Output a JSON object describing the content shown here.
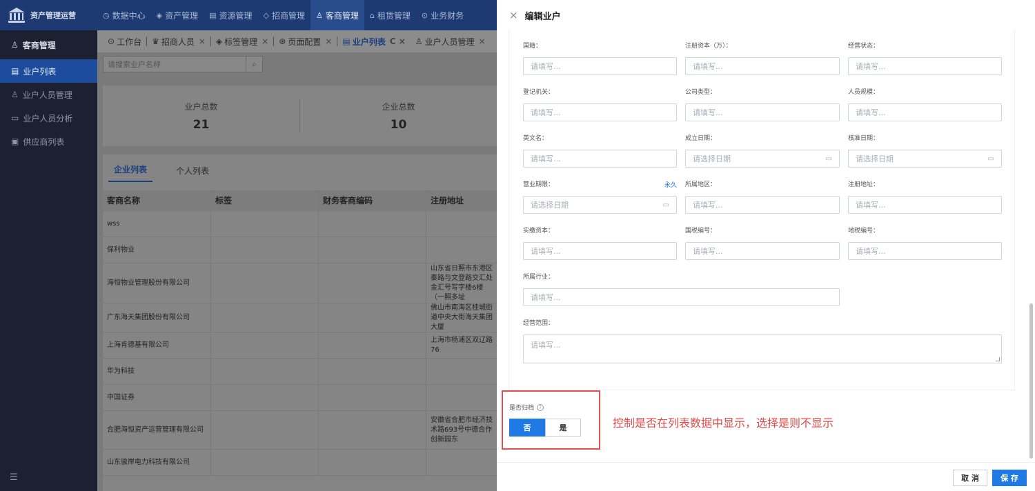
{
  "app": {
    "title": "资产管理运营"
  },
  "topnav": [
    {
      "icon": "◷",
      "label": "数据中心"
    },
    {
      "icon": "◈",
      "label": "资产管理"
    },
    {
      "icon": "▤",
      "label": "资源管理"
    },
    {
      "icon": "◇",
      "label": "招商管理"
    },
    {
      "icon": "♙",
      "label": "客商管理"
    },
    {
      "icon": "⌂",
      "label": "租赁管理"
    },
    {
      "icon": "⊙",
      "label": "业务财务"
    }
  ],
  "sidebar": {
    "header": "客商管理",
    "items": [
      {
        "icon": "▤",
        "label": "业户列表"
      },
      {
        "icon": "♙",
        "label": "业户人员管理"
      },
      {
        "icon": "▭",
        "label": "业户人员分析"
      },
      {
        "icon": "▣",
        "label": "供应商列表"
      }
    ],
    "foot_icon": "☰"
  },
  "tabs": [
    {
      "icon": "⊙",
      "label": "工作台",
      "close": ""
    },
    {
      "icon": "♛",
      "label": "招商人员",
      "close": "×"
    },
    {
      "icon": "◈",
      "label": "标签管理",
      "close": "×"
    },
    {
      "icon": "⊛",
      "label": "页面配置",
      "close": "×"
    },
    {
      "icon": "▤",
      "label": "业户列表",
      "close": "C ×"
    },
    {
      "icon": "♙",
      "label": "业户人员管理",
      "close": "×"
    }
  ],
  "search": {
    "placeholder": "请搜索业户名称",
    "icon": "⌕"
  },
  "stats": [
    {
      "label": "业户总数",
      "value": "21"
    },
    {
      "label": "企业总数",
      "value": "10"
    }
  ],
  "list_tabs": [
    "企业列表",
    "个人列表"
  ],
  "table": {
    "columns": [
      "客商名称",
      "标签",
      "财务客商编码",
      "注册地址"
    ],
    "rows": [
      {
        "name": "wss",
        "tag": "",
        "code": "",
        "addr": ""
      },
      {
        "name": "保利物业",
        "tag": "",
        "code": "",
        "addr": ""
      },
      {
        "name": "海恒物业管理股份有限公司",
        "tag": "",
        "code": "",
        "addr": "山东省日照市东港区秦路与文登路交汇处金汇号写字楼6楼（一照多址"
      },
      {
        "name": "广东海天集团股份有限公司",
        "tag": "",
        "code": "",
        "addr": "佛山市南海区桂城街道中央大街海天集团大厦"
      },
      {
        "name": "上海肯德基有限公司",
        "tag": "",
        "code": "",
        "addr": "上海市杨浦区双辽路76"
      },
      {
        "name": "华为科技",
        "tag": "",
        "code": "",
        "addr": ""
      },
      {
        "name": "中国证券",
        "tag": "",
        "code": "",
        "addr": ""
      },
      {
        "name": "合肥海恒资产运营管理有限公司",
        "tag": "",
        "code": "",
        "addr": "安徽省合肥市经济技术路693号中德合作创新园东"
      },
      {
        "name": "山东骏岸电力科技有限公司",
        "tag": "",
        "code": "",
        "addr": ""
      }
    ]
  },
  "drawer": {
    "title": "编辑业户",
    "close_icon": "×",
    "fields": [
      {
        "label": "国籍：",
        "placeholder": "请填写..."
      },
      {
        "label": "注册资本（万）：",
        "placeholder": "请填写..."
      },
      {
        "label": "经营状态：",
        "placeholder": "请填写..."
      },
      {
        "label": "登记机关：",
        "placeholder": "请填写..."
      },
      {
        "label": "公司类型：",
        "placeholder": "请填写..."
      },
      {
        "label": "人员规模：",
        "placeholder": "请填写..."
      },
      {
        "label": "英文名：",
        "placeholder": "请填写..."
      },
      {
        "label": "成立日期：",
        "placeholder": "请选择日期"
      },
      {
        "label": "核准日期：",
        "placeholder": "请选择日期"
      },
      {
        "label": "营业期限：",
        "placeholder": "请选择日期",
        "extra": "永久"
      },
      {
        "label": "所属地区：",
        "placeholder": "请填写..."
      },
      {
        "label": "注册地址：",
        "placeholder": "请填写..."
      },
      {
        "label": "实缴资本：",
        "placeholder": "请填写..."
      },
      {
        "label": "国税编号：",
        "placeholder": "请填写..."
      },
      {
        "label": "地税编号：",
        "placeholder": "请填写..."
      },
      {
        "label": "所属行业：",
        "placeholder": "请填写..."
      },
      {
        "label": "经营范围：",
        "placeholder": "请填写..."
      }
    ],
    "calendar_icon": "▭",
    "archive": {
      "label": "是否归档",
      "help_icon": "?",
      "options": [
        "否",
        "是"
      ],
      "selected": "否"
    },
    "annotation": "控制是否在列表数据中显示，选择是则不显示",
    "cancel_label": "取 消",
    "save_label": "保 存"
  },
  "colors": {
    "accent": "#1f7ae6",
    "nav_bg": "#1d3a72",
    "sidebar_bg": "#1b2130",
    "annotation": "#e04a4a"
  }
}
